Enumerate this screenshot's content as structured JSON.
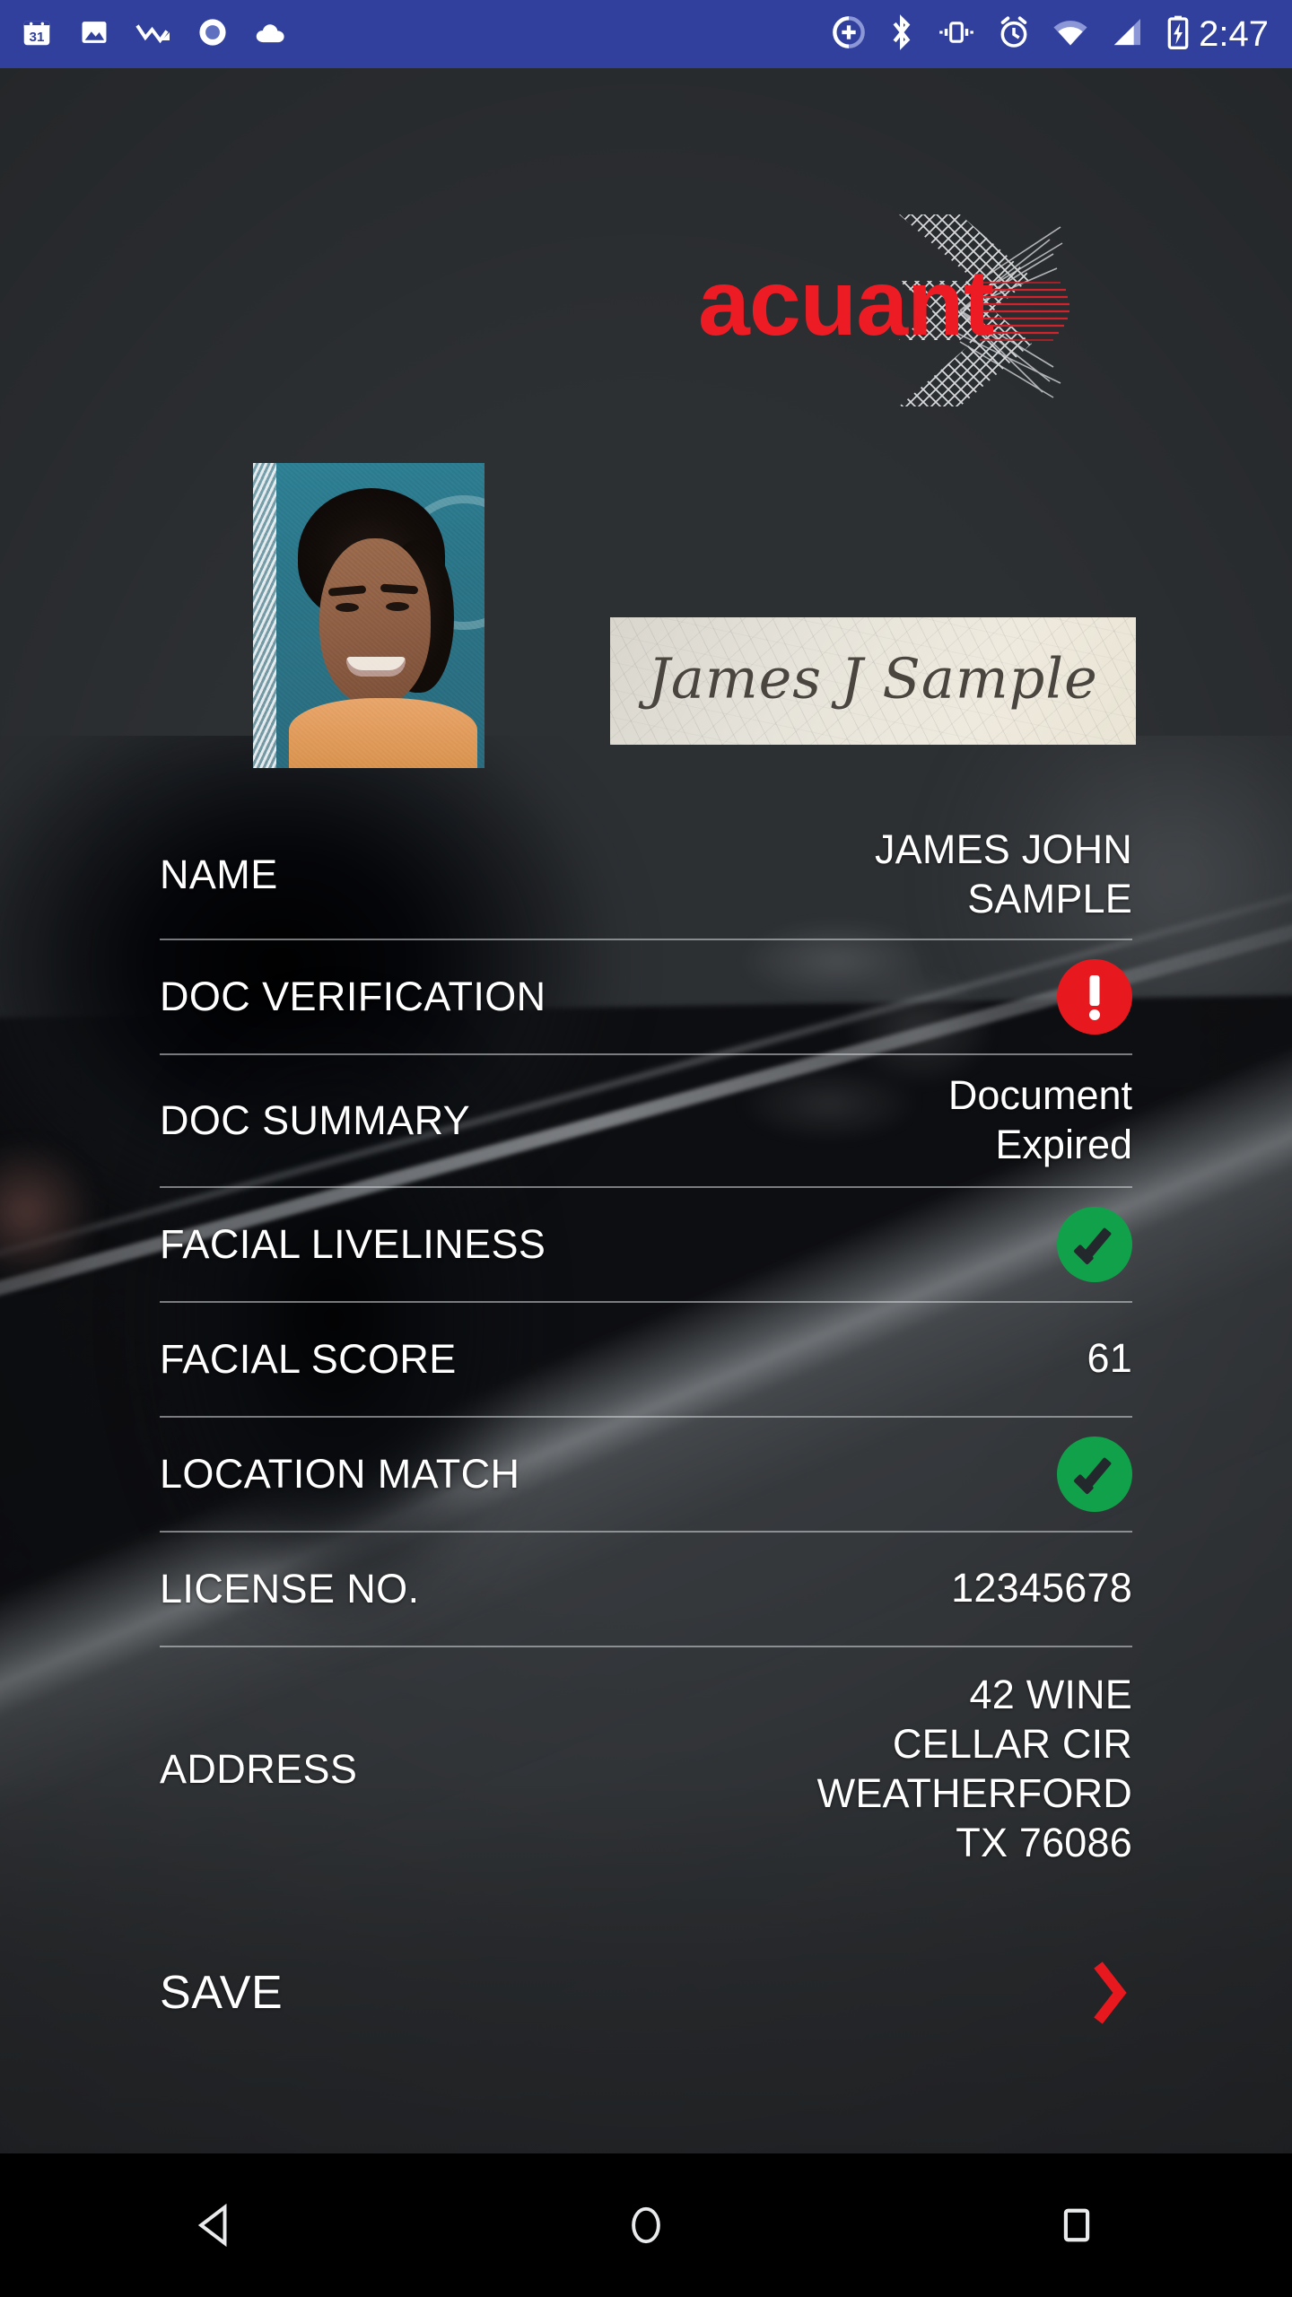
{
  "status_bar": {
    "time": "2:47",
    "background_color": "#30409C",
    "left_icons": [
      "calendar-31-icon",
      "photo-icon",
      "trending-down-icon",
      "record-circle-icon",
      "cloud-icon"
    ],
    "right_icons": [
      "sync-add-icon",
      "bluetooth-icon",
      "vibrate-icon",
      "alarm-icon",
      "wifi-icon",
      "cellular-signal-icon",
      "battery-charging-icon"
    ]
  },
  "brand": {
    "name": "acuant",
    "logo_color": "#ED1C24"
  },
  "id_images": {
    "portrait_alt": "id-portrait-photo",
    "signature_text": "James J Sample"
  },
  "details": {
    "rows": [
      {
        "label": "NAME",
        "value": "JAMES JOHN\nSAMPLE",
        "type": "text"
      },
      {
        "label": "DOC VERIFICATION",
        "value": "",
        "type": "badge-error"
      },
      {
        "label": "DOC SUMMARY",
        "value": "Document\nExpired",
        "type": "text-mixed"
      },
      {
        "label": "FACIAL LIVELINESS",
        "value": "",
        "type": "badge-ok"
      },
      {
        "label": "FACIAL SCORE",
        "value": "61",
        "type": "text"
      },
      {
        "label": "LOCATION MATCH",
        "value": "",
        "type": "badge-ok"
      },
      {
        "label": "LICENSE NO.",
        "value": "12345678",
        "type": "text"
      },
      {
        "label": "ADDRESS",
        "value": "42 WINE\nCELLAR CIR\nWEATHERFORD\nTX 76086",
        "type": "text"
      }
    ]
  },
  "actions": {
    "save_label": "SAVE",
    "save_chevron_color": "#E8191E"
  },
  "status_colors": {
    "error": "#E8191E",
    "ok": "#12A14B"
  },
  "nav_bar": {
    "back_label": "back-button",
    "home_label": "home-button",
    "recents_label": "recents-button"
  }
}
